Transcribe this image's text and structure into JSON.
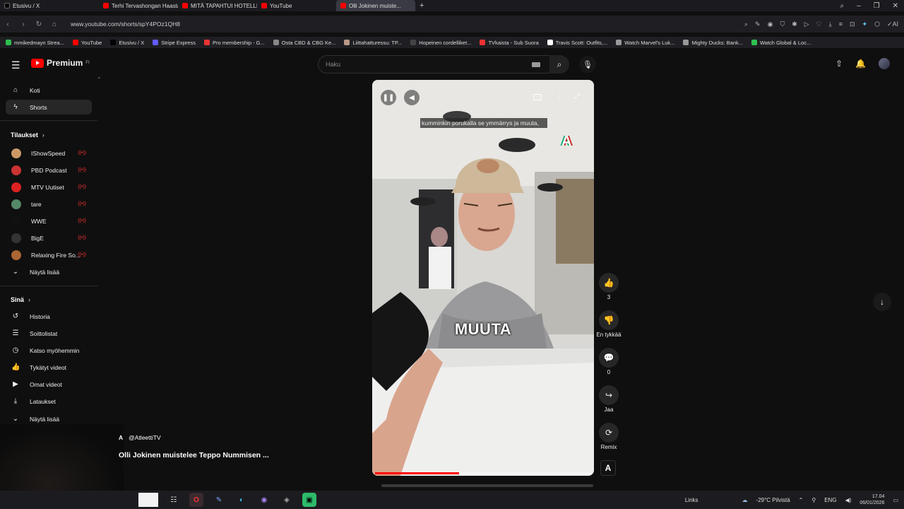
{
  "browser": {
    "tabs": [
      {
        "label": "Etusivu / X",
        "color": "#000000",
        "active": false
      },
      {
        "label": "Terhi Tervashongan Haasta...",
        "color": "#ff0000",
        "active": false
      },
      {
        "label": "MITÄ TAPAHTUI HOTELLISSA?...",
        "color": "#ff0000",
        "active": false
      },
      {
        "label": "YouTube",
        "color": "#ff0000",
        "active": false
      },
      {
        "label": "Olli Jokinen muiste...",
        "color": "#ff0000",
        "active": true
      }
    ],
    "url": "www.youtube.com/shorts/spY4POz1QH8",
    "bookmarks": [
      {
        "label": "mmikedmayn Strea...",
        "color": "#2fbf4f"
      },
      {
        "label": "YouTube",
        "color": "#ff0000"
      },
      {
        "label": "Etusivu / X",
        "color": "#000000"
      },
      {
        "label": "Stripe Express",
        "color": "#635bff"
      },
      {
        "label": "Pro membership - G...",
        "color": "#e33"
      },
      {
        "label": "Osta CBD & CBG Ke...",
        "color": "#888"
      },
      {
        "label": "Liittahatturessu: TP...",
        "color": "#b98"
      },
      {
        "label": "Hopeinen cordelliket...",
        "color": "#444"
      },
      {
        "label": "TVkaista - Sub Suora",
        "color": "#e33"
      },
      {
        "label": "Travis Scott: Outfits,...",
        "color": "#fff"
      },
      {
        "label": "Watch Marvel's Luk...",
        "color": "#999"
      },
      {
        "label": "Mighty Ducks: Bank...",
        "color": "#999"
      },
      {
        "label": "Watch Global & Loc...",
        "color": "#2fbf4f"
      }
    ]
  },
  "header": {
    "logo_text": "Premium",
    "logo_sup": "FI",
    "search_placeholder": "Haku"
  },
  "sidebar": {
    "top": [
      {
        "label": "Koti",
        "icon": "home-icon",
        "glyph": "⌂"
      },
      {
        "label": "Shorts",
        "icon": "shorts-icon",
        "glyph": "ϟ",
        "active": true
      }
    ],
    "subs_heading": "Tilaukset",
    "subs": [
      {
        "label": "IShowSpeed",
        "color": "#c96"
      },
      {
        "label": "PBD Podcast",
        "color": "#c33"
      },
      {
        "label": "MTV Uutiset",
        "color": "#d22"
      },
      {
        "label": "tare",
        "color": "#586"
      },
      {
        "label": "WWE",
        "color": "#111"
      },
      {
        "label": "BigE",
        "color": "#333"
      },
      {
        "label": "Relaxing Fire So...",
        "color": "#a63"
      }
    ],
    "show_more": "Näytä lisää",
    "you_heading": "Sinä",
    "you": [
      {
        "label": "Historia",
        "glyph": "↺"
      },
      {
        "label": "Soittolistat",
        "glyph": "☰"
      },
      {
        "label": "Katso myöhemmin",
        "glyph": "◷"
      },
      {
        "label": "Tykätyt videot",
        "glyph": "👍"
      },
      {
        "label": "Omat videot",
        "glyph": "▶"
      },
      {
        "label": "Lataukset",
        "glyph": "⤓"
      }
    ],
    "show_more_2": "Näytä lisää"
  },
  "video": {
    "subtitle_text": "kumminkin porukalla se ymmärrys ja muuta,",
    "burned_caption": "MUUTA",
    "watermark": "A",
    "progress_fraction": 0.39
  },
  "actions": {
    "like_count": "3",
    "dislike_label": "En tykkää",
    "comments_count": "0",
    "share_label": "Jaa",
    "remix_label": "Remix"
  },
  "info": {
    "channel": "@AtleettiTV",
    "title": "Olli Jokinen muistelee Teppo Nummisen ..."
  },
  "taskbar": {
    "links": "Links",
    "weather": "-29°C Pilvistä",
    "lang": "ENG",
    "time": "17.04",
    "date": "06/01/2026"
  }
}
